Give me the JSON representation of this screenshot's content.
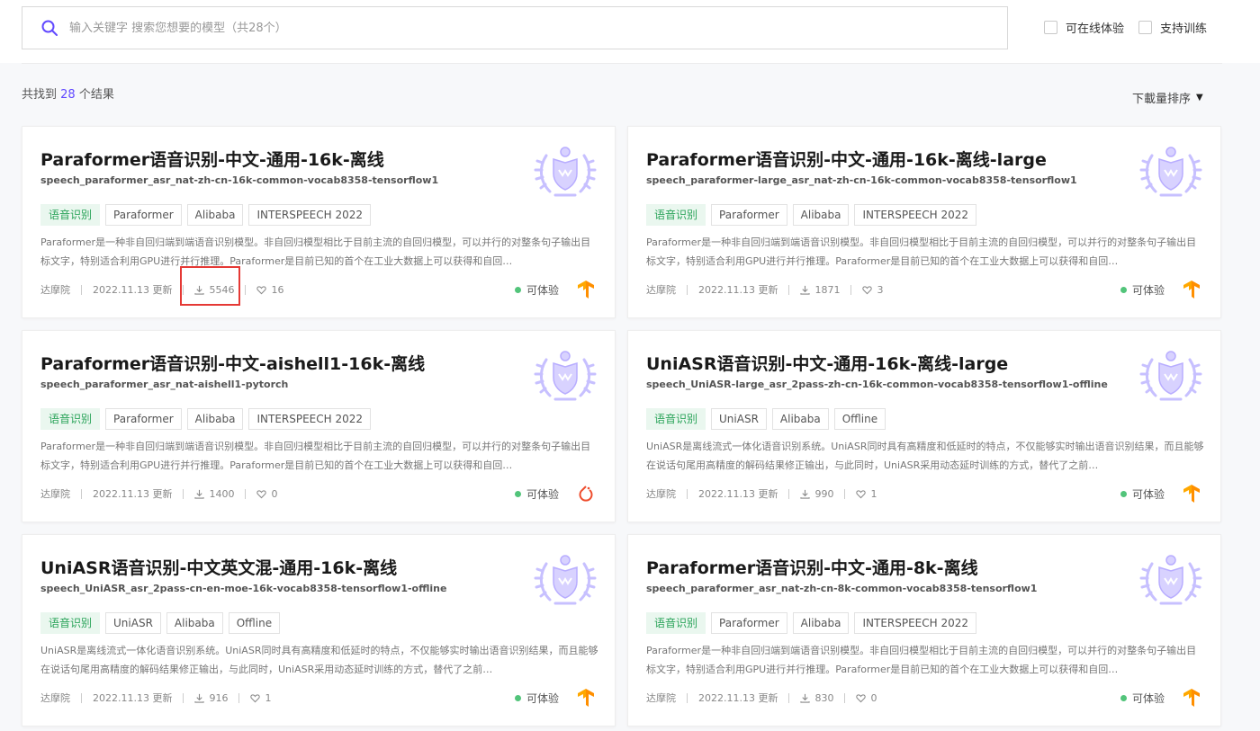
{
  "search": {
    "placeholder": "输入关键字 搜索您想要的模型（共28个）",
    "icon": "search-icon",
    "accent": "#624aff"
  },
  "filters": [
    {
      "label": "可在线体验",
      "checked": false
    },
    {
      "label": "支持训练",
      "checked": false
    }
  ],
  "results": {
    "prefix": "共找到",
    "count": "28",
    "suffix": "个结果"
  },
  "sort": {
    "label": "下載量排序",
    "icon": "caret-down-icon"
  },
  "cards": [
    {
      "title": "Paraformer语音识别-中文-通用-16k-离线",
      "subtitle": "speech_paraformer_asr_nat-zh-cn-16k-common-vocab8358-tensorflow1",
      "tags": [
        "语音识别",
        "Paraformer",
        "Alibaba",
        "INTERSPEECH 2022"
      ],
      "desc": "Paraformer是一种非自回归端到端语音识别模型。非自回归模型相比于目前主流的自回归模型，可以并行的对整条句子输出目标文字，特别适合利用GPU进行并行推理。Paraformer是目前已知的首个在工业大数据上可以获得和自回…",
      "author": "达摩院",
      "updated": "2022.11.13 更新",
      "downloads": "5546",
      "likes": "16",
      "status": "可体验",
      "framework": "tensorflow-icon"
    },
    {
      "title": "Paraformer语音识别-中文-通用-16k-离线-large",
      "subtitle": "speech_paraformer-large_asr_nat-zh-cn-16k-common-vocab8358-tensorflow1",
      "tags": [
        "语音识别",
        "Paraformer",
        "Alibaba",
        "INTERSPEECH 2022"
      ],
      "desc": "Paraformer是一种非自回归端到端语音识别模型。非自回归模型相比于目前主流的自回归模型，可以并行的对整条句子输出目标文字，特别适合利用GPU进行并行推理。Paraformer是目前已知的首个在工业大数据上可以获得和自回…",
      "author": "达摩院",
      "updated": "2022.11.13 更新",
      "downloads": "1871",
      "likes": "3",
      "status": "可体验",
      "framework": "tensorflow-icon"
    },
    {
      "title": "Paraformer语音识别-中文-aishell1-16k-离线",
      "subtitle": "speech_paraformer_asr_nat-aishell1-pytorch",
      "tags": [
        "语音识别",
        "Paraformer",
        "Alibaba",
        "INTERSPEECH 2022"
      ],
      "desc": "Paraformer是一种非自回归端到端语音识别模型。非自回归模型相比于目前主流的自回归模型，可以并行的对整条句子输出目标文字，特别适合利用GPU进行并行推理。Paraformer是目前已知的首个在工业大数据上可以获得和自回…",
      "author": "达摩院",
      "updated": "2022.11.13 更新",
      "downloads": "1400",
      "likes": "0",
      "status": "可体验",
      "framework": "pytorch-icon"
    },
    {
      "title": "UniASR语音识别-中文-通用-16k-离线-large",
      "subtitle": "speech_UniASR-large_asr_2pass-zh-cn-16k-common-vocab8358-tensorflow1-offline",
      "tags": [
        "语音识别",
        "UniASR",
        "Alibaba",
        "Offline"
      ],
      "desc": "UniASR是离线流式一体化语音识别系统。UniASR同时具有高精度和低延时的特点，不仅能够实时输出语音识别结果，而且能够在说话句尾用高精度的解码结果修正输出，与此同时，UniASR采用动态延时训练的方式，替代了之前…",
      "author": "达摩院",
      "updated": "2022.11.13 更新",
      "downloads": "990",
      "likes": "1",
      "status": "可体验",
      "framework": "tensorflow-icon"
    },
    {
      "title": "UniASR语音识别-中文英文混-通用-16k-离线",
      "subtitle": "speech_UniASR_asr_2pass-cn-en-moe-16k-vocab8358-tensorflow1-offline",
      "tags": [
        "语音识别",
        "UniASR",
        "Alibaba",
        "Offline"
      ],
      "desc": "UniASR是离线流式一体化语音识别系统。UniASR同时具有高精度和低延时的特点，不仅能够实时输出语音识别结果，而且能够在说话句尾用高精度的解码结果修正输出，与此同时，UniASR采用动态延时训练的方式，替代了之前…",
      "author": "达摩院",
      "updated": "2022.11.13 更新",
      "downloads": "916",
      "likes": "1",
      "status": "可体验",
      "framework": "tensorflow-icon"
    },
    {
      "title": "Paraformer语音识别-中文-通用-8k-离线",
      "subtitle": "speech_paraformer_asr_nat-zh-cn-8k-common-vocab8358-tensorflow1",
      "tags": [
        "语音识别",
        "Paraformer",
        "Alibaba",
        "INTERSPEECH 2022"
      ],
      "desc": "Paraformer是一种非自回归端到端语音识别模型。非自回归模型相比于目前主流的自回归模型，可以并行的对整条句子输出目标文字，特别适合利用GPU进行并行推理。Paraformer是目前已知的首个在工业大数据上可以获得和自回…",
      "author": "达摩院",
      "updated": "2022.11.13 更新",
      "downloads": "830",
      "likes": "0",
      "status": "可体验",
      "framework": "tensorflow-icon"
    }
  ],
  "colors": {
    "accent": "#624aff",
    "tag_green": "#2ba45a",
    "status_dot": "#52c47a",
    "tensorflow": "#ff8f00",
    "pytorch": "#ee4c2c",
    "highlight": "#e53935"
  }
}
